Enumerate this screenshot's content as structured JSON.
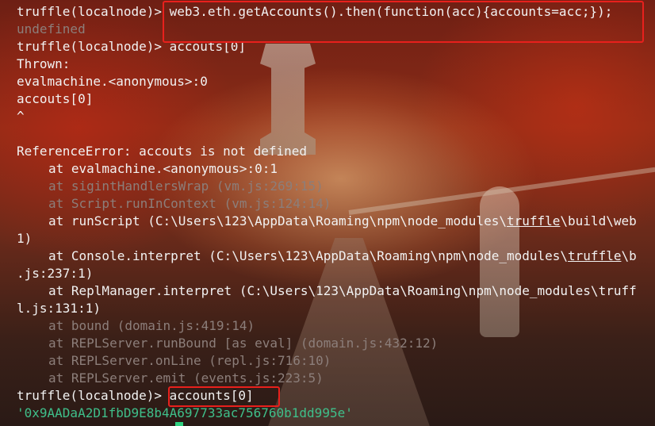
{
  "terminal": {
    "lines": [
      {
        "text": "truffle(localnode)> web3.eth.getAccounts().then(function(acc){accounts=acc;});",
        "style": "normal"
      },
      {
        "text": "undefined",
        "style": "dim"
      },
      {
        "text": "truffle(localnode)> accouts[0]",
        "style": "normal"
      },
      {
        "text": "Thrown:",
        "style": "normal"
      },
      {
        "text": "evalmachine.<anonymous>:0",
        "style": "normal"
      },
      {
        "text": "accouts[0]",
        "style": "normal"
      },
      {
        "text": "^",
        "style": "normal"
      },
      {
        "text": "",
        "style": "normal"
      },
      {
        "text": "ReferenceError: accouts is not defined",
        "style": "normal"
      },
      {
        "text": "at evalmachine.<anonymous>:0:1",
        "style": "indent"
      },
      {
        "text": "at sigintHandlersWrap (vm.js:269:15)",
        "style": "dim-indent"
      },
      {
        "text": "at Script.runInContext (vm.js:124:14)",
        "style": "dim-indent"
      },
      {
        "text": "at runScript (C:\\Users\\123\\AppData\\Roaming\\npm\\node_modules\\truffle\\build\\web",
        "style": "indent-ul"
      },
      {
        "text": "1)",
        "style": "normal"
      },
      {
        "text": "at Console.interpret (C:\\Users\\123\\AppData\\Roaming\\npm\\node_modules\\truffle\\b",
        "style": "indent-ul"
      },
      {
        "text": ".js:237:1)",
        "style": "normal"
      },
      {
        "text": "at ReplManager.interpret (C:\\Users\\123\\AppData\\Roaming\\npm\\node_modules\\truff",
        "style": "indent-ul"
      },
      {
        "text": "l.js:131:1)",
        "style": "normal"
      },
      {
        "text": "at bound (domain.js:419:14)",
        "style": "dim-indent"
      },
      {
        "text": "at REPLServer.runBound [as eval] (domain.js:432:12)",
        "style": "dim-indent"
      },
      {
        "text": "at REPLServer.onLine (repl.js:716:10)",
        "style": "dim-indent"
      },
      {
        "text": "at REPLServer.emit (events.js:223:5)",
        "style": "dim-indent"
      },
      {
        "text": "truffle(localnode)> accounts[0]",
        "style": "normal"
      },
      {
        "text": "'0x9AADaA2D1fbD9E8b4A697733ac756760b1dd995e'",
        "style": "green"
      }
    ],
    "underline_word": "truffle"
  },
  "colors": {
    "text": "#f2f2f2",
    "dim": "#8c7e7a",
    "string": "#3fbf8a",
    "highlight": "#e8201c",
    "cursor": "#2fd080"
  },
  "icons": {
    "cursor": "block-cursor"
  }
}
